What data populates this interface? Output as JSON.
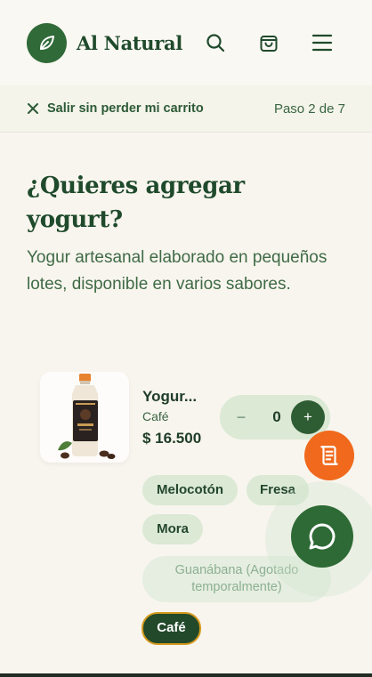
{
  "header": {
    "brand": "Al Natural",
    "icons": [
      "leaf-icon",
      "search-icon",
      "cart-icon",
      "menu-icon"
    ]
  },
  "progress": {
    "exit_label": "Salir sin perder mi carrito",
    "step_label": "Paso 2 de 7"
  },
  "main": {
    "title": "¿Quieres agregar yogurt?",
    "subtitle": "Yogur artesanal elaborado en pequeños lotes, disponible en varios sabores."
  },
  "product": {
    "name": "Yogur...",
    "flavor": "Café",
    "price": "$ 16.500",
    "quantity": "0",
    "minus": "−",
    "plus": "+",
    "image_label": "Yogur Café"
  },
  "flavors": {
    "melocoton": "Melocotón",
    "fresa": "Fresa",
    "mora": "Mora",
    "guanabana": "Guanábana (Agotado temporalmente)",
    "cafe": "Café",
    "selected": "Café"
  },
  "colors": {
    "brand_green": "#2f6a38",
    "accent_orange": "#f0691c",
    "selected_border": "#d49a1c"
  }
}
